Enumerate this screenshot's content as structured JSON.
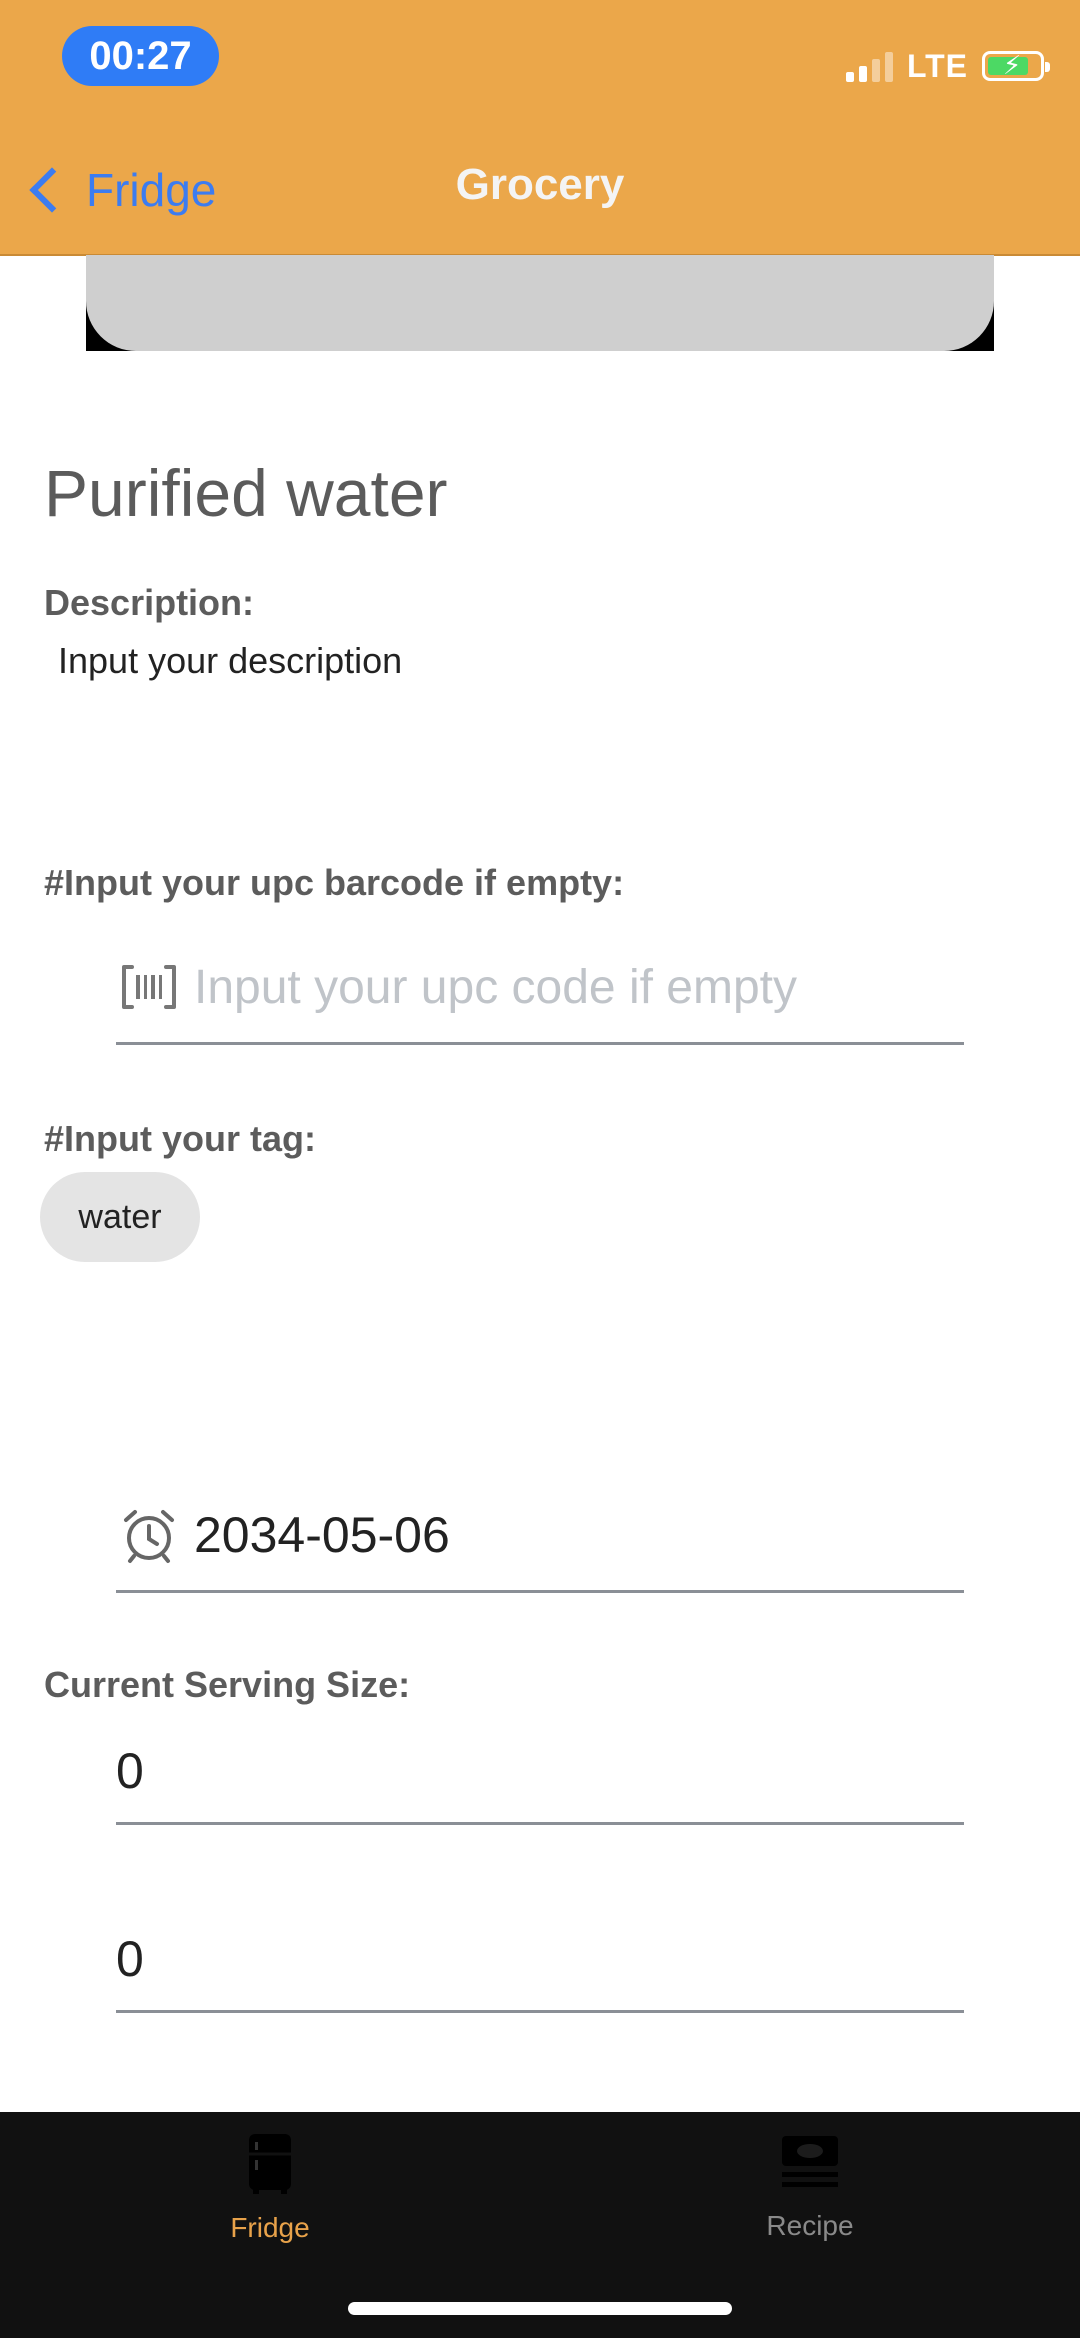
{
  "status_bar": {
    "time": "00:27",
    "network": "LTE"
  },
  "nav": {
    "back_label": "Fridge",
    "title": "Grocery"
  },
  "item": {
    "name": "Purified water"
  },
  "description": {
    "label": "Description:",
    "value": "Input your description"
  },
  "upc": {
    "label": "#Input your upc barcode if empty:",
    "placeholder": "Input your upc code if empty"
  },
  "tag": {
    "label": "#Input your tag:",
    "chips": [
      "water"
    ]
  },
  "expiry": {
    "date": "2034-05-06"
  },
  "serving": {
    "label": "Current Serving Size:",
    "current": "0",
    "total": "0"
  },
  "tabs": [
    {
      "label": "Fridge",
      "icon": "fridge-icon",
      "active": true
    },
    {
      "label": "Recipe",
      "icon": "recipe-icon",
      "active": false
    }
  ],
  "colors": {
    "header": "#EBA74A",
    "accent_blue": "#3c7cf0",
    "tab_active": "#E8A24A",
    "tab_inactive": "#8a8a8a"
  }
}
